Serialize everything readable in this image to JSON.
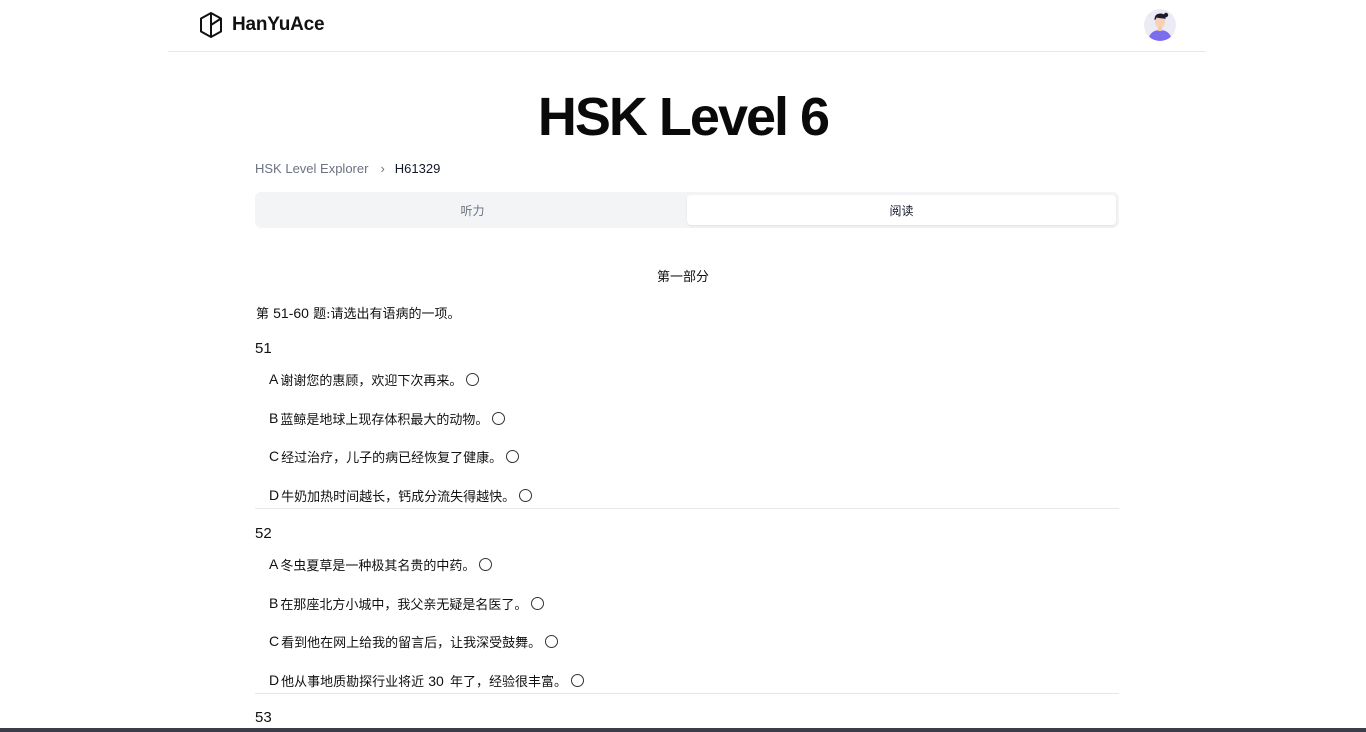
{
  "brand": {
    "name": "HanYuAce"
  },
  "page": {
    "title": "HSK Level 6"
  },
  "breadcrumb": {
    "root": "HSK Level Explorer",
    "separator": "›",
    "current": "H61329"
  },
  "tabs": [
    {
      "label": "听力",
      "active": false
    },
    {
      "label": "阅读",
      "active": true
    }
  ],
  "section": {
    "title": "第一部分",
    "instruction_prefix": "第 ",
    "instruction_range": "51-60",
    "instruction_suffix": " 题:请选出有语病的一项。"
  },
  "questions": [
    {
      "number": "51",
      "options": [
        {
          "letter": "A",
          "text": "谢谢您的惠顾，欢迎下次再来。"
        },
        {
          "letter": "B",
          "text": "蓝鲸是地球上现存体积最大的动物。"
        },
        {
          "letter": "C",
          "text": "经过治疗，儿子的病已经恢复了健康。"
        },
        {
          "letter": "D",
          "text": "牛奶加热时间越长，钙成分流失得越快。"
        }
      ]
    },
    {
      "number": "52",
      "options": [
        {
          "letter": "A",
          "text": "冬虫夏草是一种极其名贵的中药。"
        },
        {
          "letter": "B",
          "text": "在那座北方小城中，我父亲无疑是名医了。"
        },
        {
          "letter": "C",
          "text": "看到他在网上给我的留言后，让我深受鼓舞。"
        },
        {
          "letter": "D",
          "text_before": "他从事地质勘探行业将近 ",
          "text_num": "30",
          "text_after": " 年了，经验很丰富。"
        }
      ]
    },
    {
      "number": "53",
      "options": []
    }
  ],
  "colors": {
    "text": "#111111",
    "muted": "#6b7280",
    "divider": "#e5e7eb",
    "tab_bg": "#f3f4f6",
    "avatar_accent": "#7b6cf0"
  },
  "icons": {
    "logo": "cube-logo-icon",
    "avatar": "user-avatar"
  }
}
